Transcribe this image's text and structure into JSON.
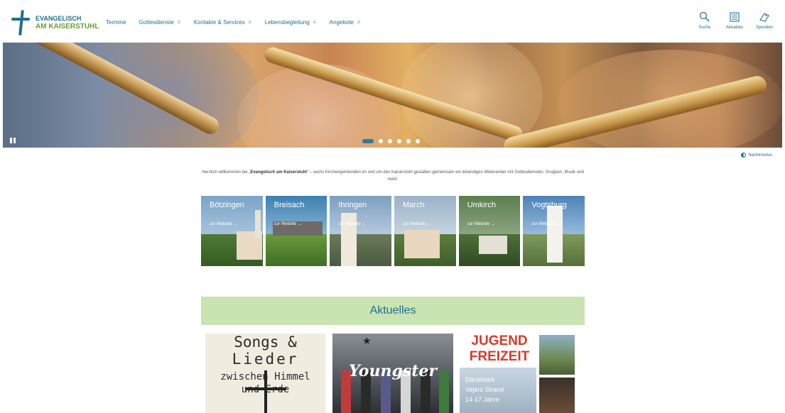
{
  "brand": {
    "line1": "EVANGELISCH",
    "line2": "AM KAISERSTUHL",
    "colors": {
      "primary": "#1e6f8c",
      "green": "#6a9e2c",
      "accent_bar": "#c9e3b2"
    }
  },
  "nav": {
    "items": [
      {
        "label": "Termine",
        "has_dropdown": false
      },
      {
        "label": "Gottesdienste",
        "has_dropdown": true
      },
      {
        "label": "Kontakte & Services",
        "has_dropdown": true
      },
      {
        "label": "Lebensbegleitung",
        "has_dropdown": true
      },
      {
        "label": "Angebote",
        "has_dropdown": true
      }
    ],
    "dropdown_glyph": "≚"
  },
  "tools": [
    {
      "label": "Suche",
      "icon": "search-icon"
    },
    {
      "label": "Aktuelles",
      "icon": "newspaper-icon"
    },
    {
      "label": "Spenden",
      "icon": "donate-icon"
    }
  ],
  "hero": {
    "slide_count": 6,
    "active_slide": 1,
    "pause_label": "pause"
  },
  "night_mode": {
    "label": "Nachtmodus",
    "icon": "contrast-icon"
  },
  "welcome": {
    "prefix": "Herzlich willkommen bei „",
    "bold": "Evangelisch am Kaiserstuhl",
    "suffix": "“ – sechs Kirchengemeinden im und um den Kaiserstuhl gestalten gemeinsam ein lebendiges Miteinander mit Gottesdiensten, Gruppen, Musik und mehr."
  },
  "parishes": [
    {
      "name": "Bötzingen",
      "link": "zur Website →"
    },
    {
      "name": "Breisach",
      "link": "zur Website →"
    },
    {
      "name": "Ihringen",
      "link": "zur Website →"
    },
    {
      "name": "March",
      "link": "zur Website →"
    },
    {
      "name": "Umkirch",
      "link": "zur Website →"
    },
    {
      "name": "Vogtsburg",
      "link": "zur Website →"
    }
  ],
  "aktuelles": {
    "heading": "Aktuelles",
    "cards": [
      {
        "line1": "Songs &",
        "line2": "Lieder",
        "line3": "zwischen   Himmel",
        "line4": "und       Erde"
      },
      {
        "title": "Youngster"
      },
      {
        "title1": "JUGEND",
        "title2": "FREIZEIT",
        "line1": "Dänemark",
        "line2": "Vejers Strand",
        "line3": "14-17 Jahre"
      }
    ]
  }
}
